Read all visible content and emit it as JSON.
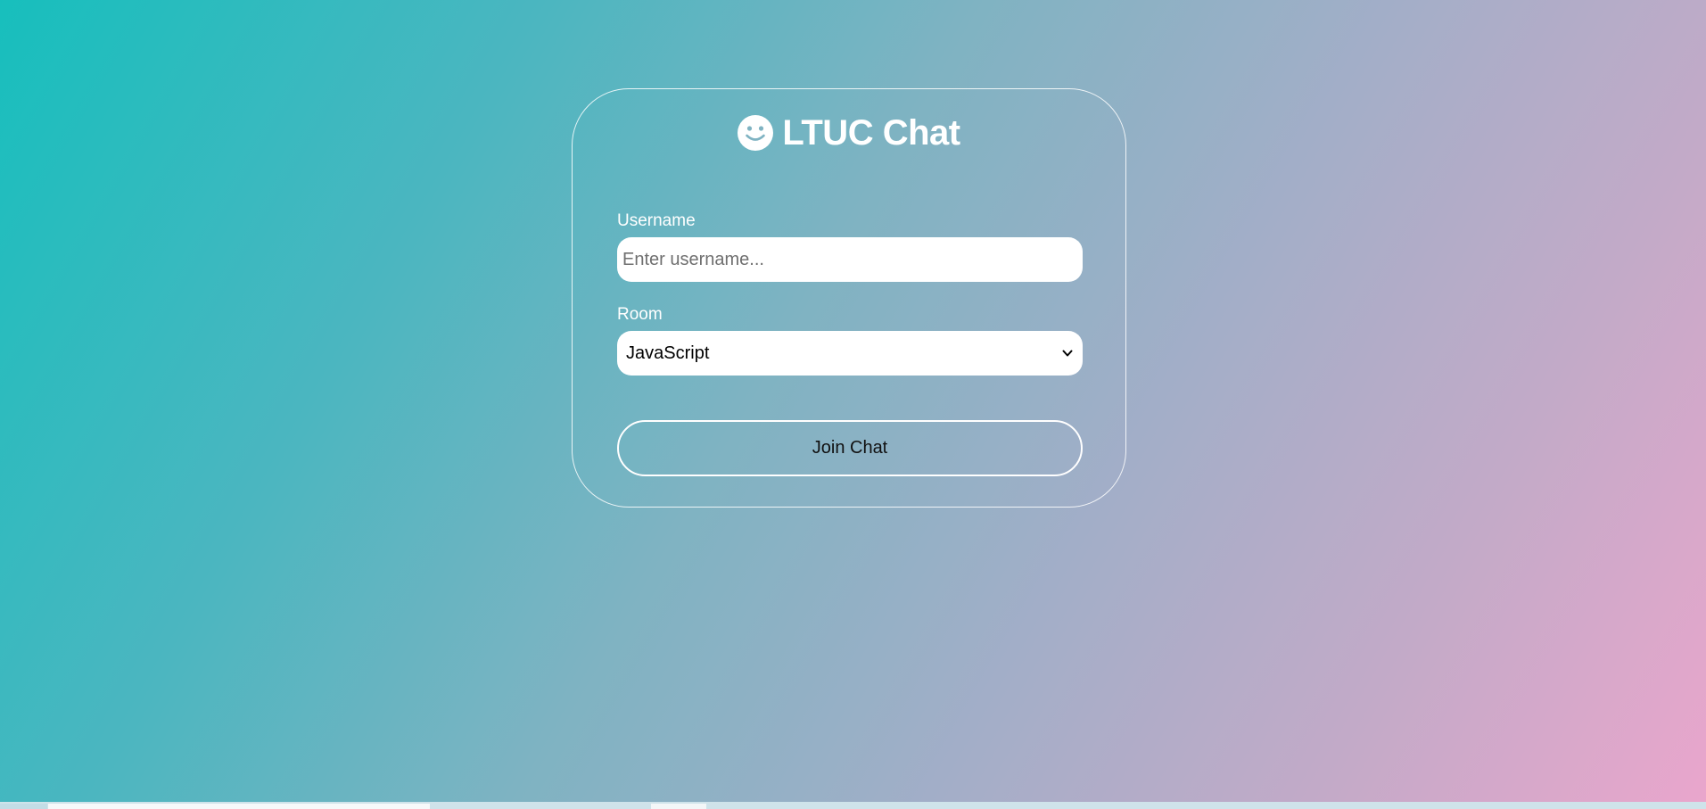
{
  "app": {
    "title": "LTUC Chat",
    "title_icon": "smile-icon"
  },
  "form": {
    "username": {
      "label": "Username",
      "value": "",
      "placeholder": "Enter username..."
    },
    "room": {
      "label": "Room",
      "selected": "JavaScript",
      "icon": "chevron-down-icon"
    },
    "join_button_label": "Join Chat"
  },
  "colors": {
    "gradient_start": "#17bfbd",
    "gradient_end": "#eaa6cc",
    "card_border": "#ffffff",
    "field_background": "#ffffff"
  }
}
